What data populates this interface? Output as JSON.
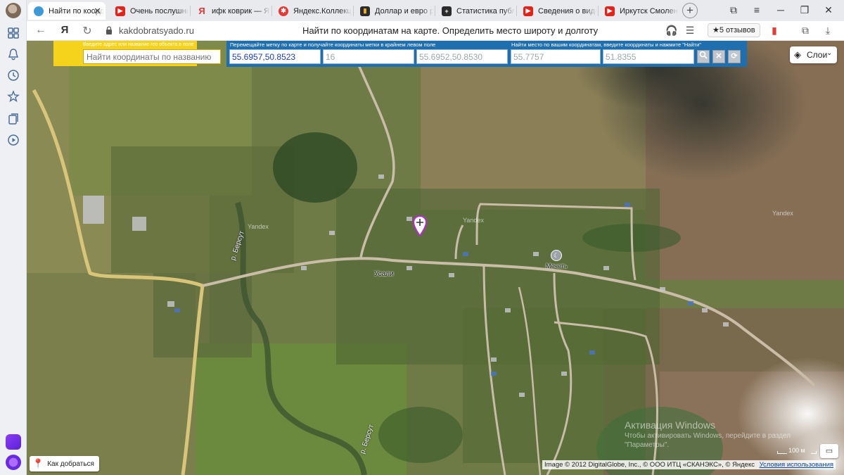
{
  "browser": {
    "tabs": [
      {
        "label": "Найти по коорд",
        "favicon": "kakdobratsyado-favicon",
        "active": true
      },
      {
        "label": "Очень послушны",
        "favicon": "youtube-favicon"
      },
      {
        "label": "ифк коврик — Ян",
        "favicon": "yandex-favicon"
      },
      {
        "label": "Яндекс.Коллекци",
        "favicon": "yandex-collections-favicon"
      },
      {
        "label": "Доллар и евро р",
        "favicon": "chart-favicon"
      },
      {
        "label": "Статистика публ",
        "favicon": "plus-favicon"
      },
      {
        "label": "Сведения о виде",
        "favicon": "youtube-favicon"
      },
      {
        "label": "Иркутск Смолен",
        "favicon": "youtube-favicon"
      }
    ],
    "tab_close_glyph": "✕",
    "new_tab_glyph": "+",
    "address": {
      "domain": "kakdobratsyado.ru",
      "page_title": "Найти по координатам на карте. Определить место широту и долготу",
      "reviews_label": "★5 отзывов"
    }
  },
  "map": {
    "name_search": {
      "hint": "Введите адрес или название гео объекта в поле",
      "placeholder": "Найти координаты по названию"
    },
    "marker_panel": {
      "hint": "Перемещайте метку по карте и получайте координаты метки в крайнем левом поле",
      "coords_value": "55.6957,50.8523",
      "zoom_value": "16",
      "center_value": "55.6952,50.8530"
    },
    "find_panel": {
      "hint": "Найти место по вашим координатам, введите координаты и нажмите \"Найти\"",
      "lat_value": "55.7757",
      "lon_value": "51.8355"
    },
    "layers_label": "Слои",
    "labels": {
      "village": "Усали",
      "mosque": "Мечеть",
      "river1": "р. Берсут",
      "river2": "р. Берсут",
      "yandex_mark": "Yandex"
    },
    "route_label": "Как добраться",
    "scale_label": "100 м",
    "copyright": "Image © 2012 DigitalGlobe, Inc., © ООО ИТЦ «СКАНЭКС», © Яндекс",
    "terms_link": "Условия использования",
    "activation": {
      "title": "Активация Windows",
      "line1": "Чтобы активировать Windows, перейдите в раздел",
      "line2": "\"Параметры\"."
    }
  }
}
